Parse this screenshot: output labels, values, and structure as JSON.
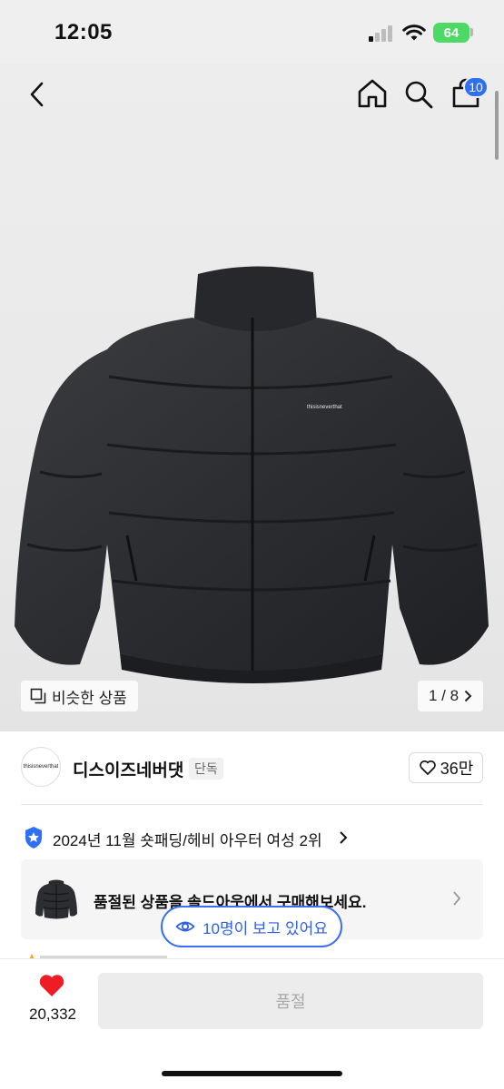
{
  "status_bar": {
    "time": "12:05",
    "battery": "64"
  },
  "header": {
    "back_icon": "chevron-left-icon",
    "home_icon": "home-icon",
    "search_icon": "search-icon",
    "cart_icon": "shopping-bag-icon",
    "cart_badge": "10"
  },
  "gallery": {
    "similar_label": "비슷한 상품",
    "page_indicator": "1 / 8",
    "jacket_brand_print": "thisisneverthat"
  },
  "brand": {
    "logo_text": "thisisneverthat",
    "name": "디스이즈네버댓",
    "tag": "단독",
    "likes": "36만"
  },
  "ranking": {
    "text": "2024년 11월 숏패딩/헤비 아우터 여성 2위"
  },
  "soldout": {
    "text": "품절된 상품을 솔드아웃에서 구매해보세요."
  },
  "viewers": {
    "text": "10명이 보고 있어요"
  },
  "bottom_bar": {
    "wish_count": "20,332",
    "buy_label": "품절"
  },
  "colors": {
    "accent_blue": "#2f6ff4",
    "heart_red": "#ee1c25",
    "battery_green": "#4cd964"
  }
}
